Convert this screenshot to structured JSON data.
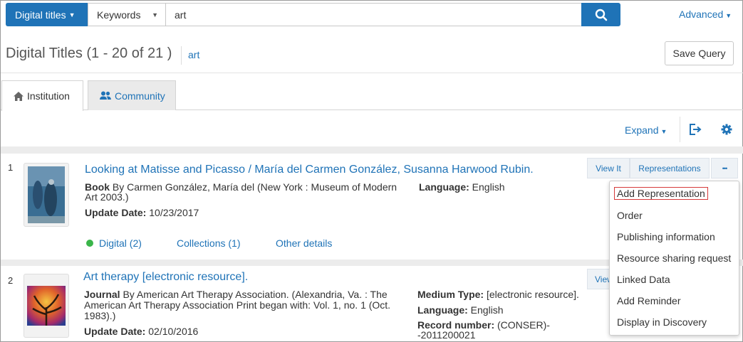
{
  "search": {
    "type_label": "Digital titles",
    "field_label": "Keywords",
    "query": "art",
    "advanced_label": "Advanced"
  },
  "header": {
    "title": "Digital Titles (1 - 20 of 21 )",
    "query_tag": "art",
    "save_query_label": "Save Query"
  },
  "tabs": [
    {
      "label": "Institution",
      "icon": "home-icon"
    },
    {
      "label": "Community",
      "icon": "users-icon"
    }
  ],
  "toolbar": {
    "expand_label": "Expand"
  },
  "results": [
    {
      "index": "1",
      "title": "Looking at Matisse and Picasso / María del Carmen González, Susanna Harwood Rubin.",
      "type": "Book",
      "desc_line1": " By Carmen González, María del (New York : Museum of Modern",
      "desc_line2": "Art 2003.)",
      "update_label": "Update Date:",
      "update_value": " 10/23/2017",
      "language_label": "Language:",
      "language_value": " English",
      "digital_link": "Digital (2)",
      "collections_link": "Collections (1)",
      "other_link": "Other details",
      "view_it": "View It",
      "representations": "Representations",
      "more": "•••"
    },
    {
      "index": "2",
      "title": "Art therapy [electronic resource].",
      "type": "Journal",
      "desc_line1": " By American Art Therapy Association. (Alexandria, Va. : The",
      "desc_line2": "American Art Therapy Association Print began with: Vol. 1, no. 1 (Oct.",
      "desc_line3": "1983).)",
      "update_label": "Update Date:",
      "update_value": " 02/10/2016",
      "medium_label": "Medium Type:",
      "medium_value": " [electronic resource].",
      "language_label": "Language:",
      "language_value": " English",
      "record_label": "Record number:",
      "record_value": " (CONSER)-",
      "record_value2": "-2011200021",
      "view_it": "View"
    }
  ],
  "menu": {
    "items": [
      "Add Representation",
      "Order",
      "Publishing information",
      "Resource sharing request",
      "Linked Data",
      "Add Reminder",
      "Display in Discovery"
    ]
  },
  "colors": {
    "primary": "#1f73b7",
    "digital_dot": "#3ab54a",
    "highlight": "#d63a3a"
  }
}
